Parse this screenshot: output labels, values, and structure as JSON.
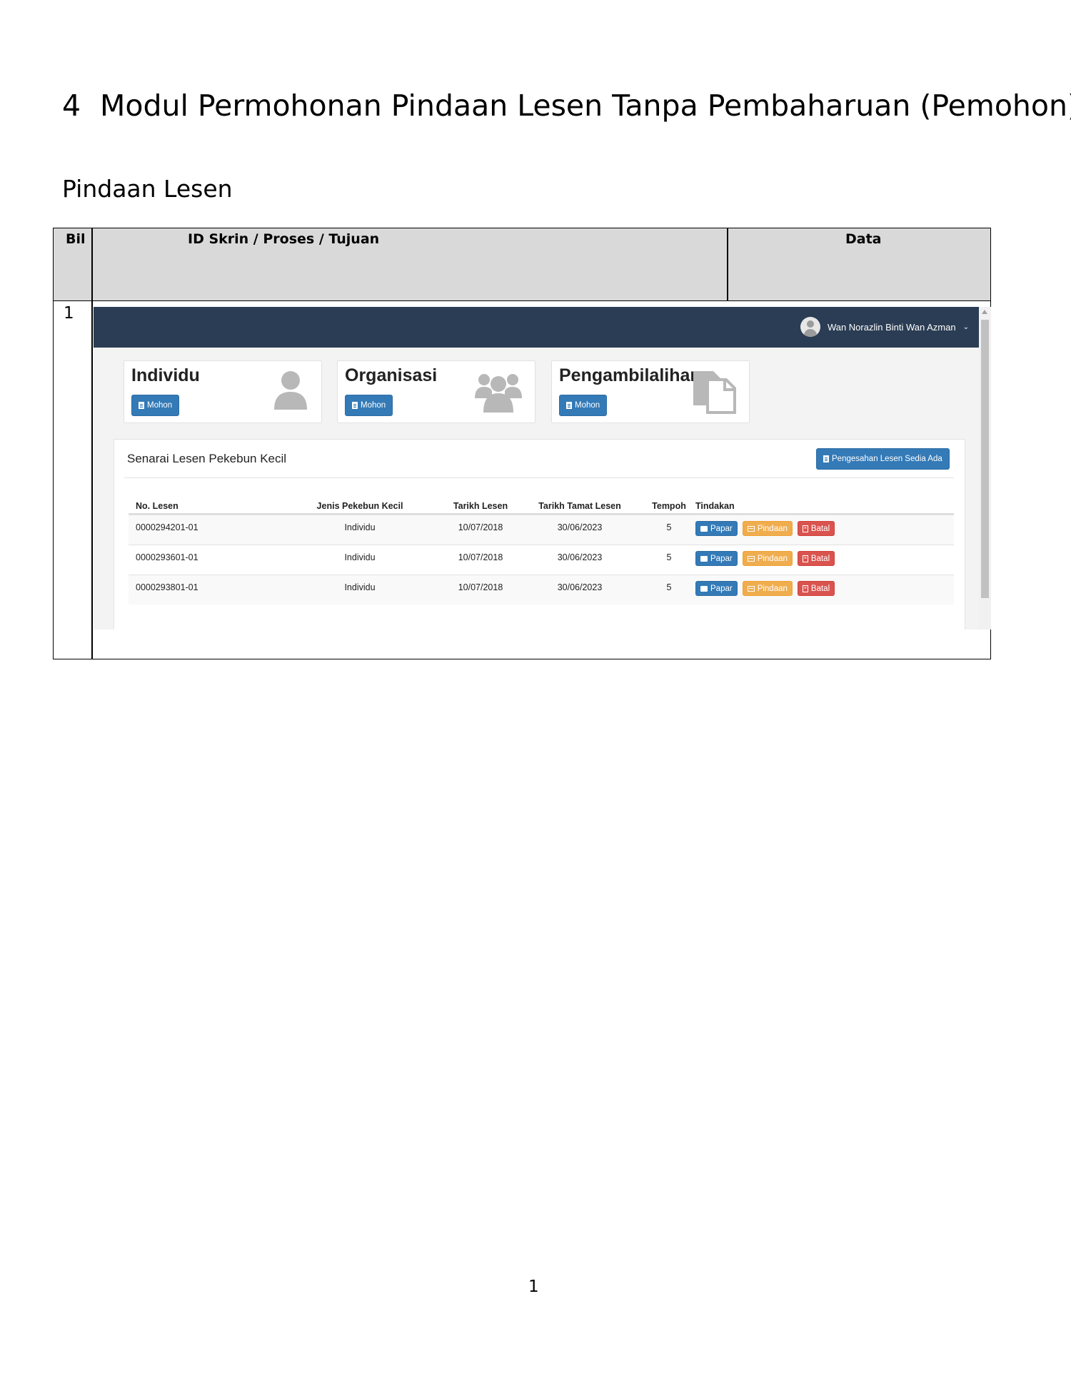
{
  "document": {
    "section_number": "4",
    "section_title": "Modul Permohonan Pindaan Lesen Tanpa Pembaharuan (Pemohon)",
    "subsection_title": "Pindaan Lesen",
    "table_headers": {
      "bil": "Bil",
      "id_skrin": "ID Skrin / Proses / Tujuan",
      "data": "Data"
    },
    "row_number": "1",
    "page_number": "1"
  },
  "app": {
    "user_name": "Wan Norazlin Binti Wan Azman",
    "cards": [
      {
        "title": "Individu",
        "button": "Mohon",
        "icon": "user-icon"
      },
      {
        "title": "Organisasi",
        "button": "Mohon",
        "icon": "users-icon"
      },
      {
        "title": "Pengambilalihan",
        "button": "Mohon",
        "icon": "copy-icon"
      }
    ],
    "panel": {
      "title": "Senarai Lesen Pekebun Kecil",
      "action_button": "Pengesahan Lesen Sedia Ada"
    },
    "table": {
      "headers": [
        "No. Lesen",
        "Jenis Pekebun Kecil",
        "Tarikh Lesen",
        "Tarikh Tamat Lesen",
        "Tempoh",
        "Tindakan"
      ],
      "rows": [
        {
          "no_lesen": "0000294201-01",
          "jenis": "Individu",
          "tarikh": "10/07/2018",
          "tamat": "30/06/2023",
          "tempoh": "5"
        },
        {
          "no_lesen": "0000293601-01",
          "jenis": "Individu",
          "tarikh": "10/07/2018",
          "tamat": "30/06/2023",
          "tempoh": "5"
        },
        {
          "no_lesen": "0000293801-01",
          "jenis": "Individu",
          "tarikh": "10/07/2018",
          "tamat": "30/06/2023",
          "tempoh": "5"
        }
      ],
      "actions": {
        "view": "Papar",
        "edit": "Pindaan",
        "cancel": "Batal"
      }
    },
    "colors": {
      "navbar": "#2b3d54",
      "primary": "#337ab7",
      "warning": "#f0ad4e",
      "danger": "#d9534f"
    }
  }
}
